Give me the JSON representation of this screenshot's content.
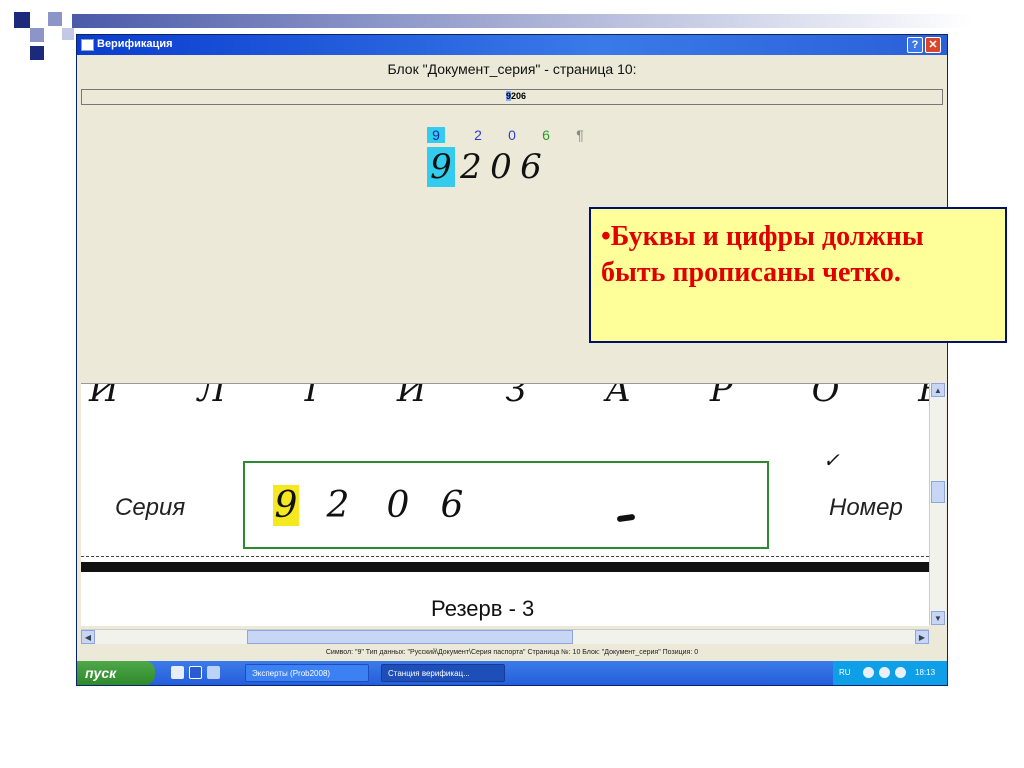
{
  "window": {
    "title": "Верификация",
    "help_label": "?",
    "close_label": "✕"
  },
  "block_title": "Блок \"Документ_серия\" - страница 10:",
  "field_value": {
    "cursor_char": "9",
    "rest": "206"
  },
  "recognized": [
    {
      "char": "9",
      "state": "selected"
    },
    {
      "char": "2",
      "state": "normal"
    },
    {
      "char": "0",
      "state": "normal"
    },
    {
      "char": "6",
      "state": "alt"
    },
    {
      "char": "¶",
      "state": "end"
    }
  ],
  "handwritten": [
    "9",
    "2",
    "0",
    "6"
  ],
  "image_area": {
    "top_letters": "И Л І И З А Р О Б И Ч",
    "serie_label": "Серия",
    "digits": [
      "9",
      "2",
      "0",
      "6"
    ],
    "nomer_label": "Номер",
    "reserve_label": "Резерв - 3"
  },
  "statusbar": "Символ: \"9\"   Тип данных: \"Русский\\Документ\\Серия паспорта\"   Страница №: 10   Блок: \"Документ_серия\"   Позиция: 0",
  "taskbar": {
    "start_label": "пуск",
    "tasks": [
      "Эксперты (Prob2008)",
      "Станция верификац..."
    ],
    "lang": "RU",
    "clock": "18:13"
  },
  "note": {
    "text": "•Буквы и цифры должны быть прописаны четко."
  },
  "colors": {
    "note_text": "#e00000",
    "note_bg": "#ffff99",
    "highlight_cyan": "#33ccee",
    "highlight_yellow": "#f5e820",
    "box_green": "#2e8a2e"
  }
}
